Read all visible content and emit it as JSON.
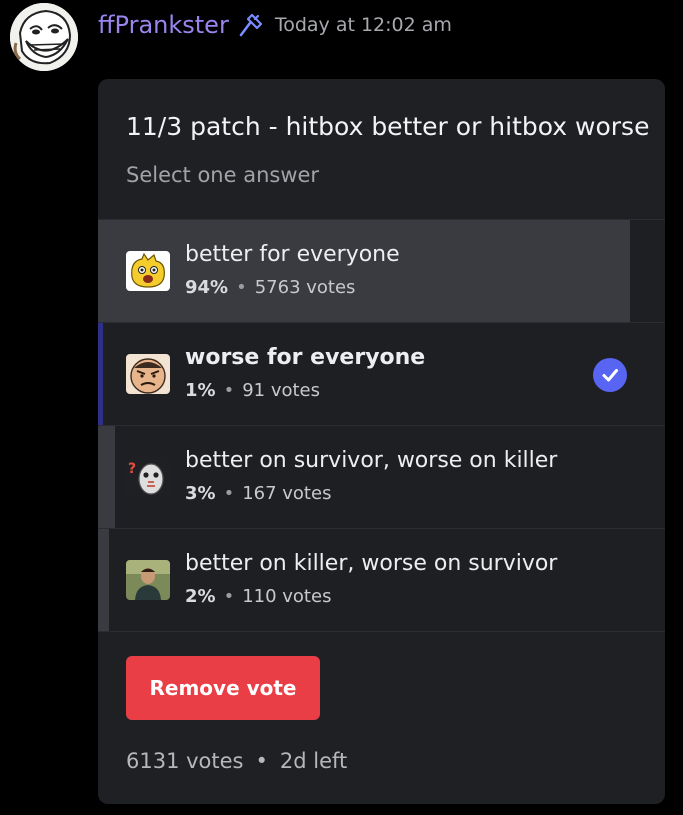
{
  "message": {
    "username": "ffPrankster",
    "timestamp": "Today at 12:02 am",
    "avatar_icon": "trollface-icon",
    "badge_icon": "hammer-icon",
    "username_color": "#9b84ee"
  },
  "poll": {
    "question": "11/3 patch - hitbox better or hitbox worse",
    "instruction": "Select one answer",
    "answers": [
      {
        "label": "better for everyone",
        "percent": "94%",
        "votes": "5763 votes",
        "fraction": 0.94,
        "emoji": "pog-emote-icon",
        "selected": false
      },
      {
        "label": "worse for everyone",
        "percent": "1%",
        "votes": "91 votes",
        "fraction": 0.01,
        "emoji": "angry-face-emote-icon",
        "selected": true
      },
      {
        "label": "better on survivor, worse on killer",
        "percent": "3%",
        "votes": "167 votes",
        "fraction": 0.03,
        "emoji": "hockey-mask-emote-icon",
        "selected": false
      },
      {
        "label": "better on killer, worse on survivor",
        "percent": "2%",
        "votes": "110 votes",
        "fraction": 0.02,
        "emoji": "man-photo-emote-icon",
        "selected": false
      }
    ],
    "remove_vote_label": "Remove vote",
    "total_votes": "6131 votes",
    "time_left": "2d left",
    "separator": "•",
    "accent_color": "#5865f2",
    "danger_color": "#ea3e47"
  }
}
